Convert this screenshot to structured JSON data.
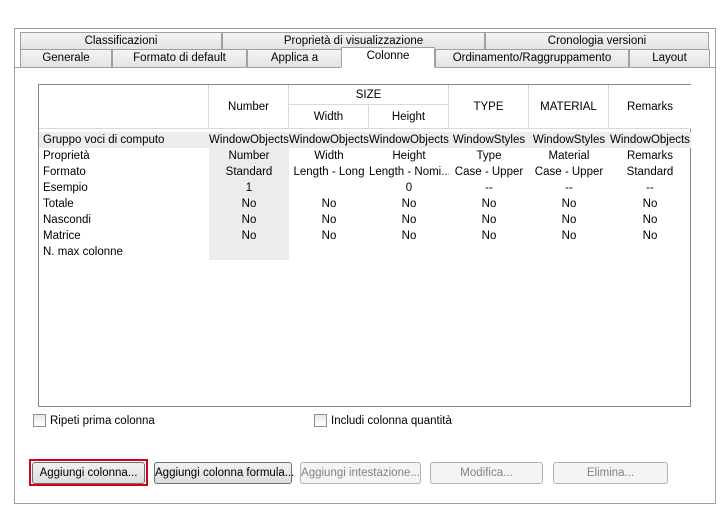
{
  "tabs_back": [
    "Classificazioni",
    "Proprietà di visualizzazione",
    "Cronologia versioni"
  ],
  "tabs_front": [
    "Generale",
    "Formato di default",
    "Applica a",
    "Colonne",
    "Ordinamento/Raggruppamento",
    "Layout"
  ],
  "active_tab": "Colonne",
  "grid": {
    "headers": {
      "number": "Number",
      "size": "SIZE",
      "width": "Width",
      "height": "Height",
      "type": "TYPE",
      "material": "MATERIAL",
      "remarks": "Remarks"
    },
    "row_labels": [
      "Gruppo voci di computo",
      "Proprietà",
      "Formato",
      "Esempio",
      "Totale",
      "Nascondi",
      "Matrice",
      "N. max colonne"
    ],
    "rows": [
      [
        "WindowObjects",
        "WindowObjects",
        "WindowObjects",
        "WindowStyles",
        "WindowStyles",
        "WindowObjects"
      ],
      [
        "Number",
        "Width",
        "Height",
        "Type",
        "Material",
        "Remarks"
      ],
      [
        "Standard",
        "Length - Long",
        "Length - Nomi...",
        "Case - Upper",
        "Case - Upper",
        "Standard"
      ],
      [
        "1",
        "",
        "0",
        "--",
        "--",
        "--"
      ],
      [
        "No",
        "No",
        "No",
        "No",
        "No",
        "No"
      ],
      [
        "No",
        "No",
        "No",
        "No",
        "No",
        "No"
      ],
      [
        "No",
        "No",
        "No",
        "No",
        "No",
        "No"
      ],
      [
        "",
        "",
        "",
        "",
        "",
        ""
      ]
    ]
  },
  "checkboxes": {
    "repeat_first": "Ripeti prima colonna",
    "include_qty": "Includi colonna quantità"
  },
  "buttons": {
    "add_column": "Aggiungi colonna...",
    "add_formula": "Aggiungi colonna formula...",
    "add_header": "Aggiungi intestazione...",
    "edit": "Modifica...",
    "delete": "Elimina..."
  },
  "colors": {
    "highlight_border": "#d0021b",
    "row_shade": "#ececec"
  }
}
